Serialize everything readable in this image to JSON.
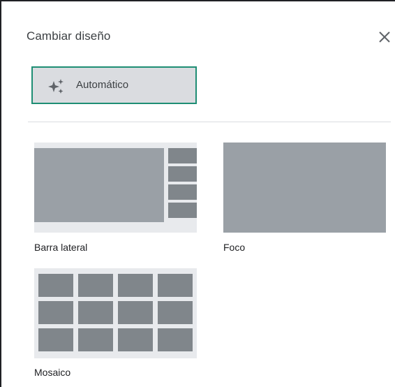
{
  "dialog": {
    "title": "Cambiar diseño",
    "close_icon": "close-icon"
  },
  "auto_option": {
    "label": "Automático",
    "icon": "sparkle-icon",
    "selected": true,
    "accent_color": "#1e8e74"
  },
  "layouts": [
    {
      "label": "Barra lateral",
      "icon": "sidebar-layout-thumbnail"
    },
    {
      "label": "Foco",
      "icon": "spotlight-layout-thumbnail"
    },
    {
      "label": "Mosaico",
      "icon": "tiled-layout-thumbnail"
    }
  ],
  "colors": {
    "tile_light": "#9aa0a6",
    "tile_dark": "#80868b",
    "thumb_bg": "#e8eaed"
  }
}
